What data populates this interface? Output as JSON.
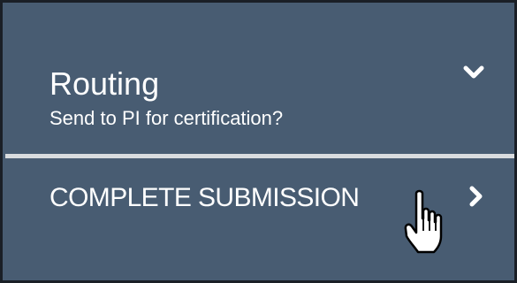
{
  "routing": {
    "title": "Routing",
    "subtitle": "Send to PI for certification?",
    "toggle_icon": "chevron-down-icon"
  },
  "complete_submission": {
    "label": "COMPLETE SUBMISSION",
    "icon": "chevron-right-icon"
  },
  "pointer": {
    "icon": "hand-pointer-icon"
  },
  "colors": {
    "panel_background": "#485c72",
    "divider": "#d9dcdf",
    "text": "#ffffff"
  }
}
